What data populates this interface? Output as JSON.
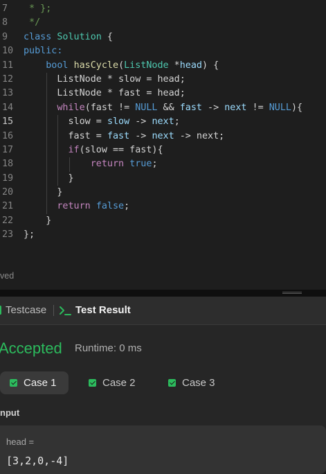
{
  "editor": {
    "lines": [
      {
        "num": "7",
        "segs": [
          {
            "t": " * };",
            "c": "cm"
          }
        ]
      },
      {
        "num": "8",
        "segs": [
          {
            "t": " */",
            "c": "cm"
          }
        ]
      },
      {
        "num": "9",
        "segs": [
          {
            "t": "class ",
            "c": "kw"
          },
          {
            "t": "Solution",
            "c": "ty"
          },
          {
            "t": " {",
            "c": "plain"
          }
        ]
      },
      {
        "num": "10",
        "segs": [
          {
            "t": "public:",
            "c": "kw"
          }
        ]
      },
      {
        "num": "11",
        "segs": [
          {
            "t": "    ",
            "c": "plain"
          },
          {
            "t": "bool ",
            "c": "kw"
          },
          {
            "t": "hasCycle",
            "c": "fn"
          },
          {
            "t": "(",
            "c": "plain"
          },
          {
            "t": "ListNode",
            "c": "ty"
          },
          {
            "t": " *",
            "c": "plain"
          },
          {
            "t": "head",
            "c": "var"
          },
          {
            "t": ") {",
            "c": "plain"
          }
        ]
      },
      {
        "num": "12",
        "segs": [
          {
            "t": "      ListNode * slow = head;",
            "c": "plain"
          }
        ]
      },
      {
        "num": "13",
        "segs": [
          {
            "t": "      ListNode * fast = head;",
            "c": "plain"
          }
        ]
      },
      {
        "num": "14",
        "segs": [
          {
            "t": "      ",
            "c": "plain"
          },
          {
            "t": "while",
            "c": "ctl"
          },
          {
            "t": "(fast != ",
            "c": "plain"
          },
          {
            "t": "NULL",
            "c": "kw"
          },
          {
            "t": " && ",
            "c": "plain"
          },
          {
            "t": "fast",
            "c": "var"
          },
          {
            "t": " -> ",
            "c": "plain"
          },
          {
            "t": "next",
            "c": "var"
          },
          {
            "t": " != ",
            "c": "plain"
          },
          {
            "t": "NULL",
            "c": "kw"
          },
          {
            "t": "){",
            "c": "plain"
          }
        ]
      },
      {
        "num": "15",
        "segs": [
          {
            "t": "        slow = ",
            "c": "plain"
          },
          {
            "t": "slow",
            "c": "var"
          },
          {
            "t": " -> ",
            "c": "plain"
          },
          {
            "t": "next",
            "c": "var"
          },
          {
            "t": ";",
            "c": "plain"
          }
        ]
      },
      {
        "num": "16",
        "segs": [
          {
            "t": "        fast = ",
            "c": "plain"
          },
          {
            "t": "fast",
            "c": "var"
          },
          {
            "t": " -> ",
            "c": "plain"
          },
          {
            "t": "next",
            "c": "var"
          },
          {
            "t": " -> next;",
            "c": "plain"
          }
        ]
      },
      {
        "num": "17",
        "segs": [
          {
            "t": "        ",
            "c": "plain"
          },
          {
            "t": "if",
            "c": "ctl"
          },
          {
            "t": "(slow == fast){",
            "c": "plain"
          }
        ]
      },
      {
        "num": "18",
        "segs": [
          {
            "t": "            ",
            "c": "plain"
          },
          {
            "t": "return ",
            "c": "ctl"
          },
          {
            "t": "true",
            "c": "kw"
          },
          {
            "t": ";",
            "c": "plain"
          }
        ]
      },
      {
        "num": "19",
        "segs": [
          {
            "t": "        }",
            "c": "plain"
          }
        ]
      },
      {
        "num": "20",
        "segs": [
          {
            "t": "      }",
            "c": "plain"
          }
        ]
      },
      {
        "num": "21",
        "segs": [
          {
            "t": "      ",
            "c": "plain"
          },
          {
            "t": "return ",
            "c": "ctl"
          },
          {
            "t": "false",
            "c": "kw"
          },
          {
            "t": ";",
            "c": "plain"
          }
        ]
      },
      {
        "num": "22",
        "segs": [
          {
            "t": "    }",
            "c": "plain"
          }
        ]
      },
      {
        "num": "23",
        "segs": [
          {
            "t": "};",
            "c": "plain"
          }
        ]
      }
    ],
    "active_line": "15",
    "status_text": "ved"
  },
  "tabs": {
    "testcase_label": "Testcase",
    "test_result_label": "Test Result"
  },
  "result": {
    "status": "Accepted",
    "runtime": "Runtime: 0 ms",
    "status_color": "#2cbb5d",
    "cases": [
      "Case 1",
      "Case 2",
      "Case 3"
    ],
    "selected_case": "Case 1",
    "input_label": "nput",
    "param_name": "head =",
    "param_value": "[3,2,0,-4]"
  }
}
